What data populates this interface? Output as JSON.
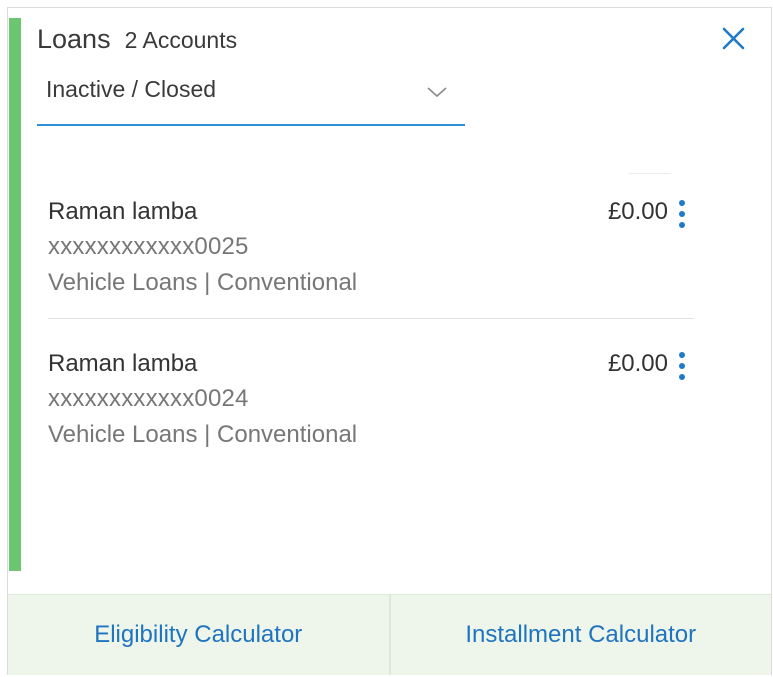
{
  "header": {
    "title": "Loans",
    "account_count": "2 Accounts",
    "close_icon": "close-icon"
  },
  "filter": {
    "selected": "Inactive / Closed",
    "icon": "chevron-down-icon"
  },
  "accounts": [
    {
      "name": "Raman lamba",
      "number": "xxxxxxxxxxxx0025",
      "type": "Vehicle Loans | Conventional",
      "amount": "£0.00"
    },
    {
      "name": "Raman lamba",
      "number": "xxxxxxxxxxxx0024",
      "type": "Vehicle Loans | Conventional",
      "amount": "£0.00"
    }
  ],
  "footer": {
    "eligibility_label": "Eligibility Calculator",
    "installment_label": "Installment Calculator"
  },
  "colors": {
    "accent_green": "#6cc570",
    "link_blue": "#1f74bf",
    "underline_blue": "#2d8fd5",
    "footer_bg": "#eef5ea"
  }
}
